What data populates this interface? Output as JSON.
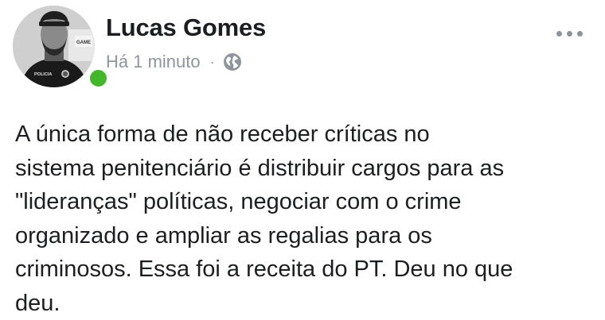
{
  "post": {
    "author": "Lucas Gomes",
    "timestamp": "Há 1 minuto",
    "separator": "·",
    "privacy_icon": "globe-icon",
    "menu_icon": "more-options-icon",
    "avatar_badge_text": "POLICIA",
    "avatar_sign_text": "GAME",
    "text_lines": [
      "A única forma de não receber críticas no",
      "sistema penitenciário é distribuir cargos para as",
      "\"lideranças\" políticas, negociar com o crime",
      "organizado e ampliar as regalias para os",
      "criminosos. Essa foi a receita do PT. Deu no que",
      "deu."
    ]
  },
  "colors": {
    "text": "#1c1e21",
    "meta": "#90949c",
    "online": "#42b72a"
  }
}
